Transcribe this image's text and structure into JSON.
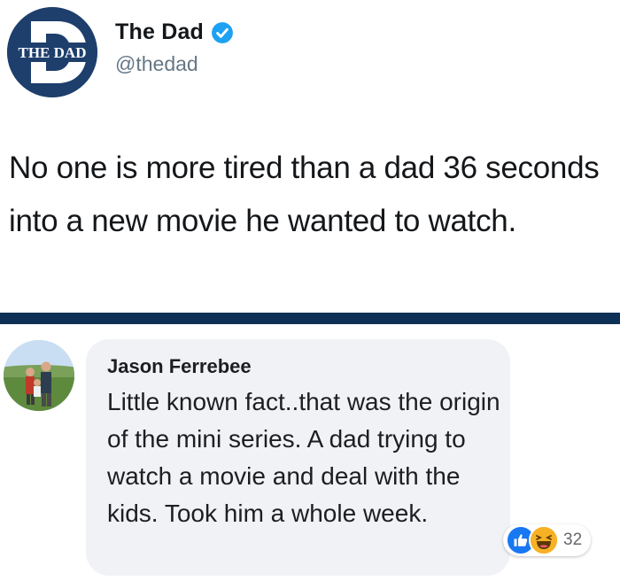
{
  "tweet": {
    "avatar_text": "THE DAD",
    "display_name": "The Dad",
    "handle": "@thedad",
    "text": "No one is more tired than a dad 36 seconds into a new movie he wanted to watch.",
    "verified_icon": "verified-badge-icon"
  },
  "comment": {
    "author": "Jason Ferrebee",
    "text": "Little known fact..that was the origin of the mini series. A dad trying to watch a movie and deal with the kids. Took him a whole week.",
    "reactions": {
      "icons": [
        "like-icon",
        "haha-icon"
      ],
      "count": "32"
    }
  },
  "colors": {
    "brand_navy": "#1e3f6c",
    "divider": "#0e3057",
    "twitter_blue": "#1da1f2",
    "fb_blue": "#1877f2",
    "bubble": "#f0f2f5"
  }
}
